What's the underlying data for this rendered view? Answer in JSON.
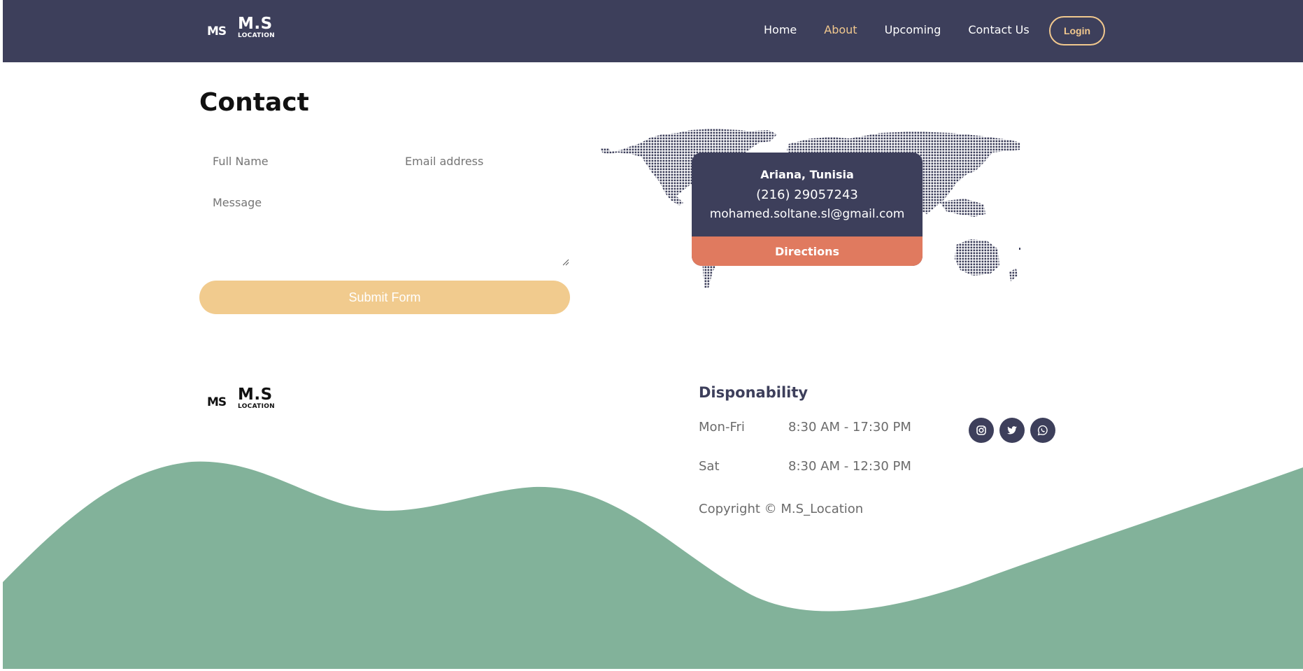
{
  "brand": {
    "name": "M.S",
    "sub": "LOCATION",
    "mark": "MS"
  },
  "nav": {
    "items": [
      {
        "label": "Home"
      },
      {
        "label": "About",
        "active": true
      },
      {
        "label": "Upcoming"
      },
      {
        "label": "Contact Us"
      }
    ],
    "login_label": "Login"
  },
  "contact": {
    "title": "Contact",
    "form": {
      "name_placeholder": "Full Name",
      "email_placeholder": "Email address",
      "message_placeholder": "Message",
      "submit_label": "Submit Form"
    },
    "info": {
      "city": "Ariana, Tunisia",
      "phone": "(216) 29057243",
      "email": "mohamed.soltane.sl@gmail.com",
      "directions_label": "Directions"
    }
  },
  "footer": {
    "brand": {
      "name": "M.S",
      "sub": "LOCATION",
      "mark": "MS"
    },
    "dispo_title": "Disponability",
    "hours": [
      {
        "day": "Mon-Fri",
        "time": "8:30 AM - 17:30 PM"
      },
      {
        "day": "Sat",
        "time": "8:30 AM - 12:30 PM"
      }
    ],
    "copyright": "Copyright © M.S_Location",
    "socials": [
      "instagram-icon",
      "twitter-icon",
      "whatsapp-icon"
    ]
  },
  "colors": {
    "navy": "#3d3f5b",
    "accent": "#f1c88e",
    "submit": "#f1cb8e",
    "directions": "#e07a5f",
    "wave": "#82b29a"
  }
}
